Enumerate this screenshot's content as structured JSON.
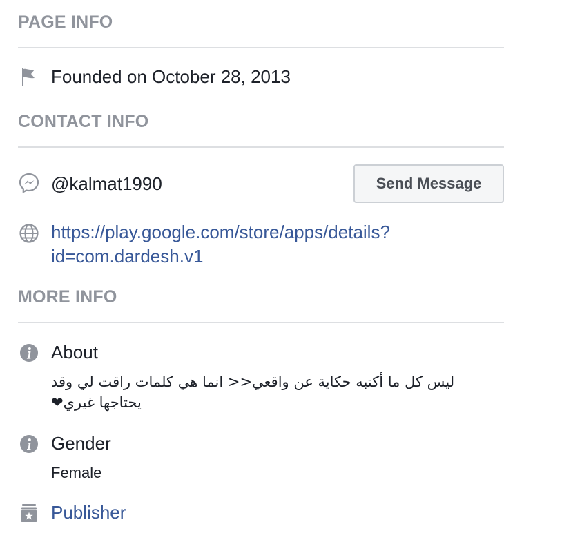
{
  "page_info": {
    "title": "PAGE INFO",
    "founded": {
      "icon": "flag-icon",
      "text": "Founded on October 28, 2013"
    }
  },
  "contact_info": {
    "title": "CONTACT INFO",
    "messenger": {
      "icon": "messenger-icon",
      "username": "@kalmat1990",
      "button_label": "Send Message"
    },
    "website": {
      "icon": "globe-icon",
      "url": "https://play.google.com/store/apps/details?id=com.dardesh.v1"
    }
  },
  "more_info": {
    "title": "MORE INFO",
    "about": {
      "icon": "info-icon",
      "label": "About",
      "text": "ليس كل ما أكتبه حكاية عن واقعي<< انما هي كلمات راقت لي وقد يحتاجها غيري❤"
    },
    "gender": {
      "icon": "info-icon",
      "label": "Gender",
      "value": "Female"
    },
    "category": {
      "icon": "publisher-icon",
      "label": "Publisher"
    }
  },
  "colors": {
    "section_title": "#90949c",
    "link": "#385898",
    "text": "#1d2129",
    "icon": "#90949c",
    "divider": "#dddfe2"
  }
}
